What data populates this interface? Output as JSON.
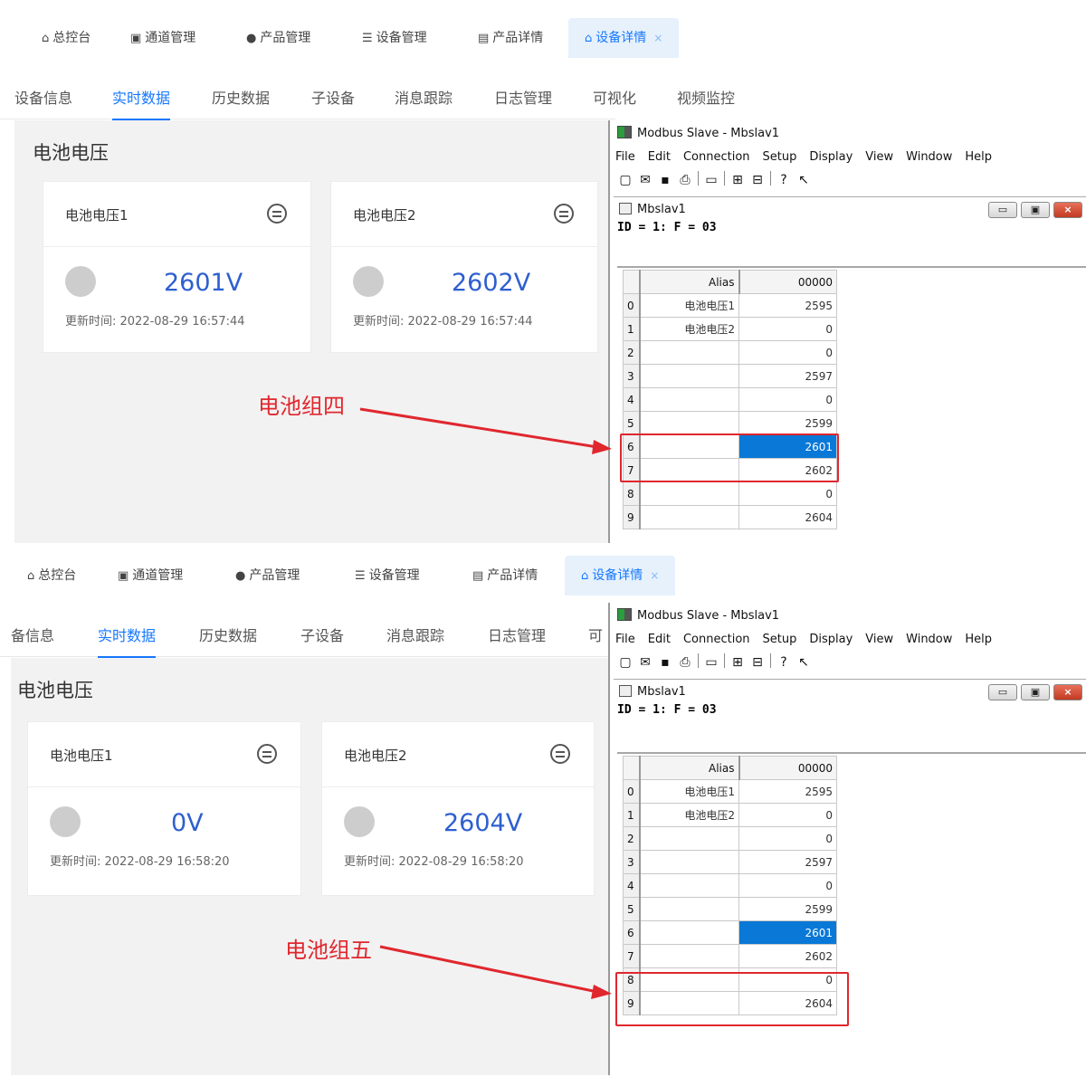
{
  "top_tabs": [
    {
      "label": "总控台",
      "icon": "home-icon"
    },
    {
      "label": "通道管理",
      "icon": "channel-icon"
    },
    {
      "label": "产品管理",
      "icon": "product-icon"
    },
    {
      "label": "设备管理",
      "icon": "device-list-icon"
    },
    {
      "label": "产品详情",
      "icon": "code-icon"
    },
    {
      "label": "设备详情",
      "icon": "house-icon",
      "active": true,
      "close": "×"
    }
  ],
  "sub_tabs": [
    "设备信息",
    "实时数据",
    "历史数据",
    "子设备",
    "消息跟踪",
    "日志管理",
    "可视化",
    "视频监控"
  ],
  "sub_tabs_cropped": [
    "备信息",
    "实时数据",
    "历史数据",
    "子设备",
    "消息跟踪",
    "日志管理",
    "可"
  ],
  "section_title": "电池电压",
  "colors": {
    "accent": "#1677ff",
    "value": "#2e5fcf",
    "annotation": "#e0272e",
    "selected_cell": "#0a78d7"
  },
  "panels": [
    {
      "cards": [
        {
          "name": "电池电压1",
          "value": "2601V",
          "updated": "更新时间: 2022-08-29 16:57:44"
        },
        {
          "name": "电池电压2",
          "value": "2602V",
          "updated": "更新时间: 2022-08-29 16:57:44"
        }
      ],
      "annotation": "电池组四"
    },
    {
      "cards": [
        {
          "name": "电池电压1",
          "value": "0V",
          "updated": "更新时间: 2022-08-29 16:58:20"
        },
        {
          "name": "电池电压2",
          "value": "2604V",
          "updated": "更新时间: 2022-08-29 16:58:20"
        }
      ],
      "annotation": "电池组五"
    }
  ],
  "modbus": {
    "title": "Modbus Slave - Mbslav1",
    "menu": [
      "File",
      "Edit",
      "Connection",
      "Setup",
      "Display",
      "View",
      "Window",
      "Help"
    ],
    "child_title": "Mbslav1",
    "id_line": "ID = 1: F = 03",
    "col_alias": "Alias",
    "col_value": "00000",
    "rows": [
      {
        "n": "0",
        "alias": "电池电压1",
        "value": "2595"
      },
      {
        "n": "1",
        "alias": "电池电压2",
        "value": "0"
      },
      {
        "n": "2",
        "alias": "",
        "value": "0"
      },
      {
        "n": "3",
        "alias": "",
        "value": "2597"
      },
      {
        "n": "4",
        "alias": "",
        "value": "0"
      },
      {
        "n": "5",
        "alias": "",
        "value": "2599"
      },
      {
        "n": "6",
        "alias": "",
        "value": "2601"
      },
      {
        "n": "7",
        "alias": "",
        "value": "2602"
      },
      {
        "n": "8",
        "alias": "",
        "value": "0"
      },
      {
        "n": "9",
        "alias": "",
        "value": "2604"
      }
    ],
    "selected_row": "6"
  }
}
